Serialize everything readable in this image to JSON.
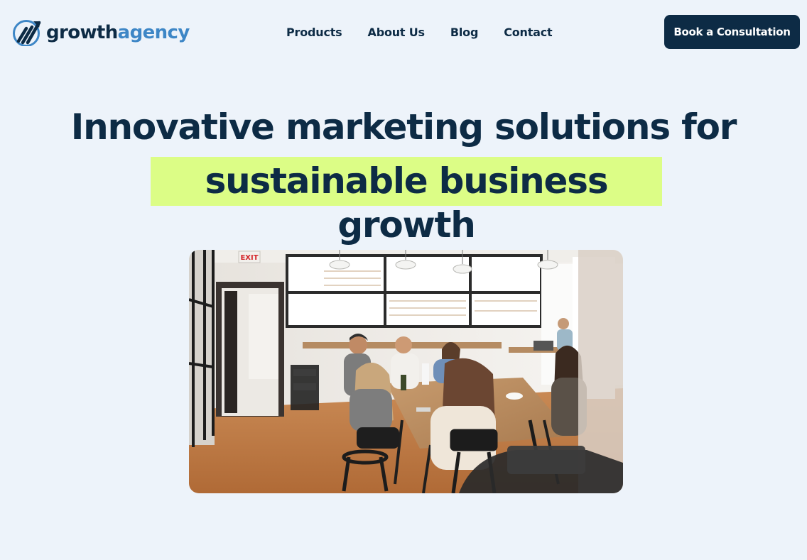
{
  "brand": {
    "logo_icon": "growth-chart-logo-icon",
    "name_part1": "growth",
    "name_part2": "agency",
    "color_dark": "#0d2b45",
    "color_accent": "#3d86c6"
  },
  "nav": {
    "items": [
      {
        "label": "Products"
      },
      {
        "label": "About Us"
      },
      {
        "label": "Blog"
      },
      {
        "label": "Contact"
      }
    ]
  },
  "cta": {
    "label": "Book a Consultation"
  },
  "hero": {
    "headline_line1": "Innovative marketing solutions for",
    "headline_line2": "sustainable business growth",
    "highlight_color": "#dcfd86"
  },
  "photo": {
    "exit_sign": "EXIT",
    "subject": "team meeting around a wooden table in an open-plan office"
  }
}
